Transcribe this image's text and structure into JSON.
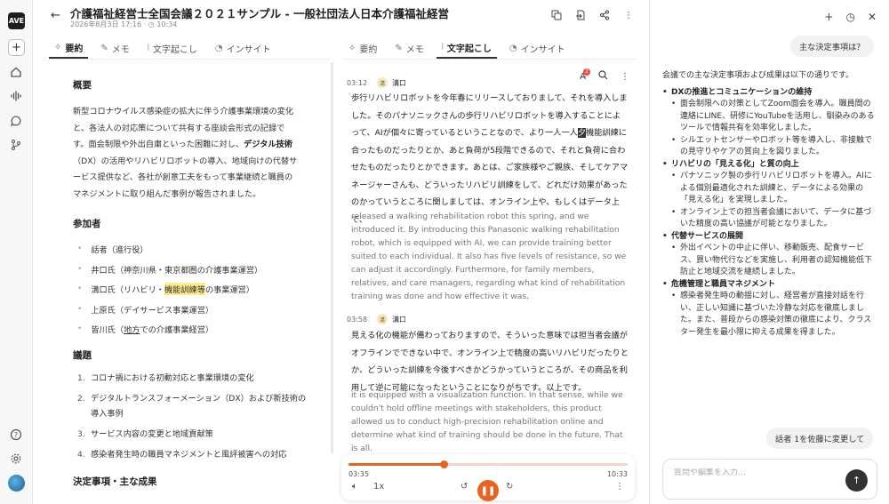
{
  "app": {
    "logo_text": "AVE"
  },
  "header": {
    "title": "介護福祉経営士全国会議２０２１サンプル - 一般社団法人日本介護福祉経営",
    "datetime": "2026年8月3日 17:16",
    "duration": "10:34"
  },
  "left_tabs": [
    {
      "label": "要約",
      "icon": "sparkle-icon",
      "active": true
    },
    {
      "label": "メモ",
      "icon": "edit-icon",
      "active": false
    },
    {
      "label": "文字起こし",
      "icon": "waveform-icon",
      "active": false
    },
    {
      "label": "インサイト",
      "icon": "insight-icon",
      "active": false
    }
  ],
  "right_tabs": [
    {
      "label": "要約",
      "icon": "sparkle-icon",
      "active": false
    },
    {
      "label": "メモ",
      "icon": "edit-icon",
      "active": false
    },
    {
      "label": "文字起こし",
      "icon": "waveform-icon",
      "active": true
    },
    {
      "label": "インサイト",
      "icon": "insight-icon",
      "active": false
    }
  ],
  "summary": {
    "overview_heading": "概要",
    "overview_pre": "新型コロナウイルス感染症の拡大に伴う介護事業環境の変化と、各法人の対応策について共有する座談会形式の記録です。面会制限や外出自粛といった困難に対し、",
    "overview_bold": "デジタル技術",
    "overview_post": "（DX）の活用やリハビリロボットの導入、地域向けの代替サービス提供など、各社が創意工夫をもって事業継続と職員のマネジメントに取り組んだ事例が報告されました。",
    "participants_heading": "参加者",
    "participants": [
      "話者（進行役）",
      "井口氏（神奈川県・東京都圏の介護事業運営）",
      "溝口氏（リハビリ・",
      "上原氏（デイサービス事業運営）",
      "皆川氏（",
      "議題"
    ],
    "p3_highlight": "機能訓練等",
    "p3_tail": "の事業運営）",
    "p5_underline": "地方",
    "p5_tail": "での介護事業経営）",
    "topics_heading": "議題",
    "topics": [
      "コロナ禍における初動対応と事業環境の変化",
      "デジタルトランスフォーメーション（DX）および新技術の導入事例",
      "サービス内容の変更と地域貢献策",
      "感染者発生時の職員マネジメントと風評被害への対応"
    ],
    "decisions_heading": "決定事項・主な成果"
  },
  "transcript": {
    "segments": [
      {
        "time": "03:12",
        "speaker_initial": "溝",
        "speaker": "溝口",
        "jp_pre": "歩行リハビリロボットを今年春にリリースしておりまして、それを導入しました。そのパナソニックさんの歩行リハビリロボットを導入することによって、AIが個々に寄っているということなので、より一人一人",
        "jp_cursor": "夕",
        "jp_post": "機能訓練に合ったものだったりとか、あと負荷が5段階できるので、それと負荷に合わせたものだったりとかできます。あとは、ご家族様やご親族、そしてケアマネージャーさんも、どういったリハビリ訓練をして、どれだけ効果があったのかっていうところに関しましては、オンライン上や、もしくはデータ上で、",
        "en": "released a walking rehabilitation robot this spring, and we introduced it. By introducing this Panasonic walking rehabilitation robot, which is equipped with AI, we can provide training better suited to each individual. It also has five levels of resistance, so we can adjust it accordingly. Furthermore, for family members, relatives, and care managers, regarding what kind of rehabilitation training was done and how effective it was,"
      },
      {
        "time": "03:58",
        "speaker_initial": "溝",
        "speaker": "溝口",
        "jp": "見える化の機能が備わっておりますので、そういった意味では担当者会議がオフラインでできない中で、オンライン上で精度の高いリハビリだったりとか、どういった訓練を今後すべきかどうかっていうところが、その商品を利用して逆に可能になったということになりがちです。以上です。",
        "en": "it is equipped with a visualization function. In that sense, while we couldn't hold offline meetings with stakeholders, this product allowed us to conduct high-precision rehabilitation online and determine what kind of training should be done in the future. That is all."
      }
    ],
    "badge_count": "2"
  },
  "player": {
    "current": "03:35",
    "total": "10:33",
    "progress": 0.34,
    "speed": "1x"
  },
  "chat": {
    "user_question": "主な決定事項は？",
    "answer_intro": "会議での主な決定事項および成果は以下の通りです。",
    "sections": [
      {
        "title": "DXの推進とコミュニケーションの維持",
        "items": [
          "面会制限への対策としてZoom面会を導入。職員間の連絡にLINE、研修にYouTubeを活用し、馴染みのあるツールで情報共有を効率化しました。",
          "シルエットセンサーやロボット等を導入し、非接触での見守りやケアの質向上を図りました。"
        ]
      },
      {
        "title": "リハビリの「見える化」と質の向上",
        "items": [
          "パナソニック製の歩行リハビリロボットを導入。AIによる個別最適化された訓練と、データによる効果の「見える化」を実現しました。",
          "オンライン上での担当者会議において、データに基づいた精度の高い協議が可能となりました。"
        ]
      },
      {
        "title": "代替サービスの展開",
        "items": [
          "外出イベントの中止に伴い、移動販売、配食サービス、買い物代行などを実施し、利用者の認知機能低下防止と地域交流を継続しました。"
        ]
      },
      {
        "title": "危機管理と職員マネジメント",
        "items": [
          "感染者発生時の動揺に対し、経営者が直接対話を行い、正しい知識に基づいた冷静な対応を徹底しました。また、普段からの感染対策の徹底により、クラスター発生を最小限に抑える成果を得ました。"
        ]
      }
    ],
    "suggestion": "話者 1を佐藤に変更して",
    "input_placeholder": "質問や編集を入力…"
  },
  "colors": {
    "accent": "#e8631f",
    "highlight": "#fbeb8a"
  }
}
